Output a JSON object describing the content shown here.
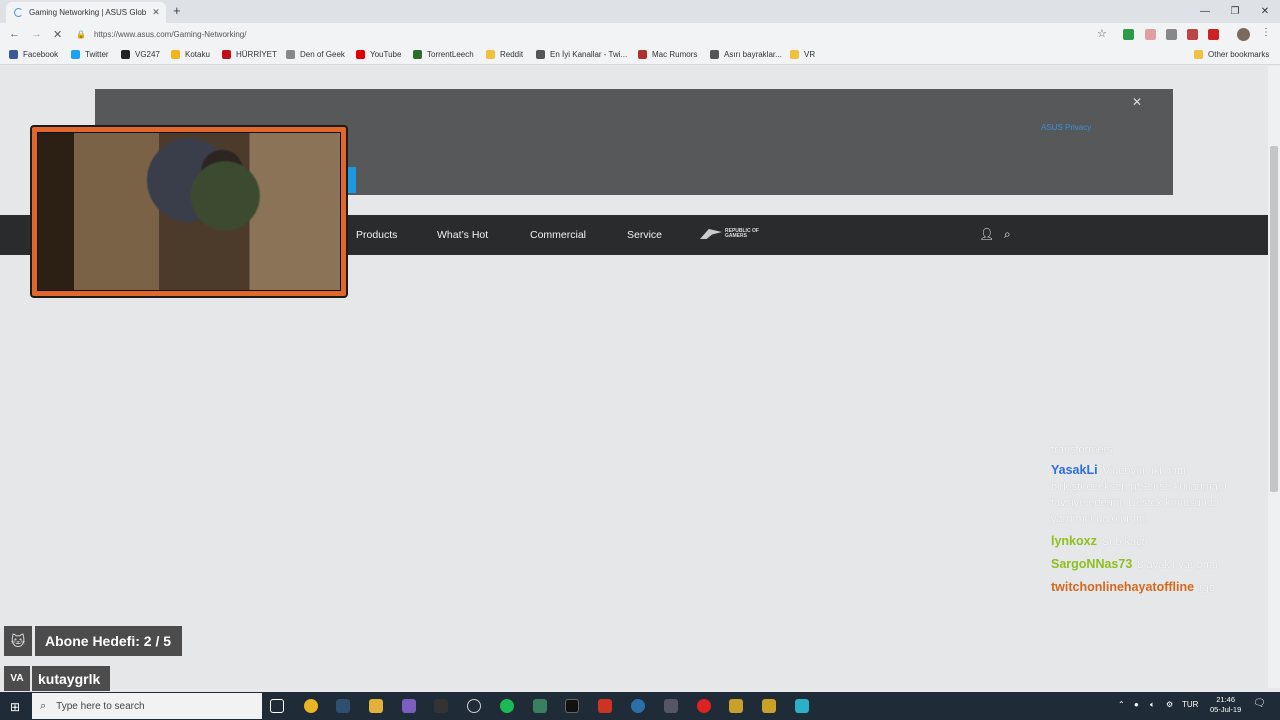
{
  "browser": {
    "tab_title": "Gaming Networking | ASUS Glob",
    "tab_close": "✕",
    "new_tab": "+",
    "url": "https://www.asus.com/Gaming-Networking/",
    "bookmarks": [
      {
        "label": "Facebook",
        "color": "#3b5998"
      },
      {
        "label": "Twitter",
        "color": "#1da1f2"
      },
      {
        "label": "VG247",
        "color": "#222222"
      },
      {
        "label": "Kotaku",
        "color": "#f2b51c"
      },
      {
        "label": "HÜRRİYET",
        "color": "#c0101a"
      },
      {
        "label": "Den of Geek",
        "color": "#888888"
      },
      {
        "label": "YouTube",
        "color": "#e00000"
      },
      {
        "label": "TorrentLeech",
        "color": "#2a6e2a"
      },
      {
        "label": "Reddit",
        "color": "#f0c040"
      },
      {
        "label": "En İyi Kanallar - Twi...",
        "color": "#555555"
      },
      {
        "label": "Mac Rumors",
        "color": "#b03030"
      },
      {
        "label": "Asırı bayraklar...",
        "color": "#555555"
      },
      {
        "label": "VR",
        "color": "#f0c040"
      }
    ],
    "other_bookmarks": "Other bookmarks"
  },
  "page": {
    "cookie_link": "ASUS Privacy",
    "cookie_close": "✕",
    "nav": [
      {
        "label": "Products"
      },
      {
        "label": "What’s Hot"
      },
      {
        "label": "Commercial"
      },
      {
        "label": "Service"
      }
    ],
    "rog_text": "REPUBLIC OF GAMERS"
  },
  "chat": {
    "top_msg": "transformers",
    "messages": [
      {
        "name": "YasakLi",
        "color": "#2e6fe0",
        "msg": "Videoyun iki hattı birleştireceksen pfSense kullanmanı tavsiye ederim. Destek konusunda yardımcı da olurum."
      },
      {
        "name": "lynkoxz",
        "color": "#8fbf1f",
        "msg": "Sub kaçtı"
      },
      {
        "name": "SargoNNas73",
        "color": "#8fbf1f",
        "msg": "8 ayaklı var omu"
      },
      {
        "name": "twitchonlinehayatoffline",
        "color": "#d2691e",
        "msg": "rgb"
      }
    ]
  },
  "overlay": {
    "sub_goal": "Abone Hedefi: 2 / 5",
    "handle": "kutaygrlk"
  },
  "taskbar": {
    "search_placeholder": "Type here to search",
    "lang": "TUR",
    "time": "21:46",
    "date": "05-Jul-19"
  }
}
